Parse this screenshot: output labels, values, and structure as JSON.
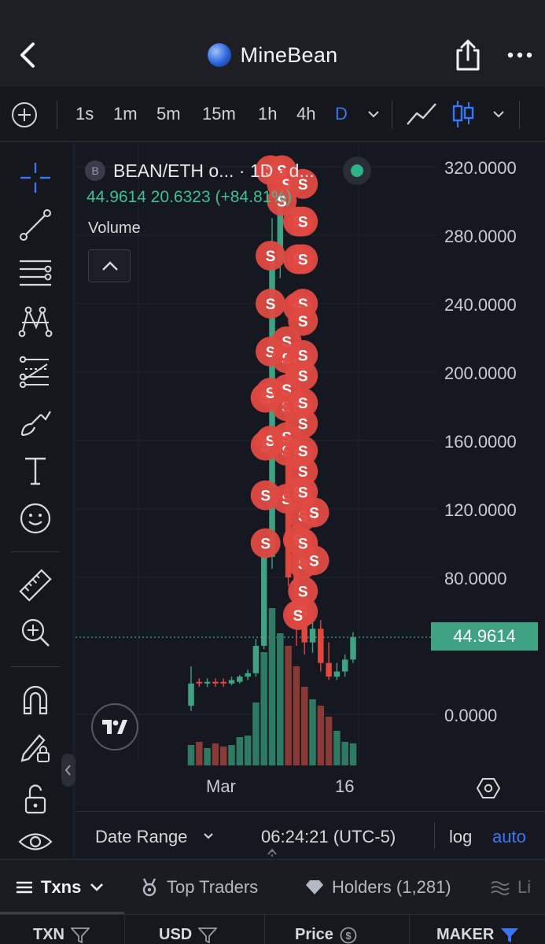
{
  "header": {
    "title": "MineBean"
  },
  "toolbar": {
    "timeframes": [
      "1s",
      "1m",
      "5m",
      "15m",
      "1h",
      "4h",
      "D"
    ],
    "active_timeframe": "D"
  },
  "chart": {
    "pair_label": "BEAN/ETH o... · 1D · d...",
    "coin_initial": "B",
    "ohlc_text": "44.9614  20.6323 (+84.81%)",
    "volume_label": "Volume",
    "current_price": "44.9614",
    "price_axis": [
      "320.0000",
      "280.0000",
      "240.0000",
      "200.0000",
      "160.0000",
      "120.0000",
      "80.0000",
      "0.0000"
    ],
    "time_axis": [
      "Mar",
      "16"
    ],
    "date_range_label": "Date Range",
    "clock": "06:24:21 (UTC-5)",
    "scale_log": "log",
    "scale_auto": "auto",
    "sell_marker_label": "S",
    "colors": {
      "up": "#3fa383",
      "down": "#e0473f",
      "marker": "#df4a42",
      "accent": "#3b76f6"
    }
  },
  "chart_data": {
    "type": "candlestick",
    "ylim": [
      0,
      320
    ],
    "y_ticks": [
      0,
      80,
      120,
      160,
      200,
      240,
      280,
      320
    ],
    "candles": [
      {
        "o": 5,
        "c": 18,
        "h": 28,
        "l": 2,
        "up": true
      },
      {
        "o": 19,
        "c": 18,
        "h": 21,
        "l": 16,
        "up": false
      },
      {
        "o": 18,
        "c": 19,
        "h": 21,
        "l": 16,
        "up": true
      },
      {
        "o": 19,
        "c": 18,
        "h": 21,
        "l": 16,
        "up": false
      },
      {
        "o": 19,
        "c": 18,
        "h": 21,
        "l": 16,
        "up": false
      },
      {
        "o": 18,
        "c": 20,
        "h": 22,
        "l": 17,
        "up": true
      },
      {
        "o": 19,
        "c": 22,
        "h": 23,
        "l": 18,
        "up": true
      },
      {
        "o": 22,
        "c": 24,
        "h": 26,
        "l": 20,
        "up": true
      },
      {
        "o": 24,
        "c": 40,
        "h": 44,
        "l": 22,
        "up": true
      },
      {
        "o": 40,
        "c": 92,
        "h": 95,
        "l": 38,
        "up": true
      },
      {
        "o": 92,
        "c": 265,
        "h": 290,
        "l": 85,
        "up": true
      },
      {
        "o": 265,
        "c": 305,
        "h": 318,
        "l": 255,
        "up": true
      },
      {
        "o": 220,
        "c": 80,
        "h": 225,
        "l": 75,
        "up": false
      },
      {
        "o": 92,
        "c": 60,
        "h": 95,
        "l": 40,
        "up": false
      },
      {
        "o": 62,
        "c": 42,
        "h": 70,
        "l": 35,
        "up": false
      },
      {
        "o": 42,
        "c": 50,
        "h": 58,
        "l": 36,
        "up": true
      },
      {
        "o": 50,
        "c": 30,
        "h": 55,
        "l": 25,
        "up": false
      },
      {
        "o": 30,
        "c": 22,
        "h": 42,
        "l": 20,
        "up": false
      },
      {
        "o": 22,
        "c": 25,
        "h": 30,
        "l": 20,
        "up": true
      },
      {
        "o": 25,
        "c": 32,
        "h": 35,
        "l": 22,
        "up": true
      },
      {
        "o": 32,
        "c": 45,
        "h": 48,
        "l": 30,
        "up": true
      }
    ],
    "volume": [
      {
        "v": 0.13,
        "up": true
      },
      {
        "v": 0.15,
        "up": false
      },
      {
        "v": 0.11,
        "up": true
      },
      {
        "v": 0.14,
        "up": false
      },
      {
        "v": 0.12,
        "up": false
      },
      {
        "v": 0.13,
        "up": true
      },
      {
        "v": 0.18,
        "up": true
      },
      {
        "v": 0.19,
        "up": true
      },
      {
        "v": 0.4,
        "up": true
      },
      {
        "v": 0.72,
        "up": true
      },
      {
        "v": 1.0,
        "up": true
      },
      {
        "v": 0.84,
        "up": true
      },
      {
        "v": 0.76,
        "up": false
      },
      {
        "v": 0.63,
        "up": false
      },
      {
        "v": 0.5,
        "up": false
      },
      {
        "v": 0.42,
        "up": true
      },
      {
        "v": 0.38,
        "up": false
      },
      {
        "v": 0.31,
        "up": false
      },
      {
        "v": 0.22,
        "up": true
      },
      {
        "v": 0.15,
        "up": true
      },
      {
        "v": 0.14,
        "up": true
      }
    ],
    "sell_markers": [
      {
        "i": 10,
        "p": 318
      },
      {
        "i": 11,
        "p": 310
      },
      {
        "i": 11,
        "p": 318
      },
      {
        "i": 12,
        "p": 310
      },
      {
        "i": 14,
        "p": 310
      },
      {
        "i": 11,
        "p": 300
      },
      {
        "i": 13,
        "p": 288
      },
      {
        "i": 14,
        "p": 288
      },
      {
        "i": 10,
        "p": 268
      },
      {
        "i": 13,
        "p": 266
      },
      {
        "i": 14,
        "p": 266
      },
      {
        "i": 10,
        "p": 240
      },
      {
        "i": 13,
        "p": 238
      },
      {
        "i": 14,
        "p": 240
      },
      {
        "i": 14,
        "p": 230
      },
      {
        "i": 10,
        "p": 212
      },
      {
        "i": 12,
        "p": 218
      },
      {
        "i": 12,
        "p": 208
      },
      {
        "i": 13,
        "p": 205
      },
      {
        "i": 14,
        "p": 210
      },
      {
        "i": 14,
        "p": 198
      },
      {
        "i": 9,
        "p": 185
      },
      {
        "i": 10,
        "p": 188
      },
      {
        "i": 12,
        "p": 190
      },
      {
        "i": 12,
        "p": 180
      },
      {
        "i": 13,
        "p": 180
      },
      {
        "i": 14,
        "p": 182
      },
      {
        "i": 14,
        "p": 170
      },
      {
        "i": 9,
        "p": 157
      },
      {
        "i": 10,
        "p": 160
      },
      {
        "i": 12,
        "p": 162
      },
      {
        "i": 12,
        "p": 154
      },
      {
        "i": 13,
        "p": 152
      },
      {
        "i": 14,
        "p": 154
      },
      {
        "i": 14,
        "p": 142
      },
      {
        "i": 9,
        "p": 128
      },
      {
        "i": 12,
        "p": 126
      },
      {
        "i": 13,
        "p": 130
      },
      {
        "i": 14,
        "p": 130
      },
      {
        "i": 14,
        "p": 116
      },
      {
        "i": 15,
        "p": 118
      },
      {
        "i": 9,
        "p": 100
      },
      {
        "i": 13,
        "p": 102
      },
      {
        "i": 14,
        "p": 100
      },
      {
        "i": 14,
        "p": 88
      },
      {
        "i": 15,
        "p": 90
      },
      {
        "i": 14,
        "p": 72
      },
      {
        "i": 14,
        "p": 60
      },
      {
        "i": 13,
        "p": 58
      }
    ]
  },
  "tabs": [
    {
      "label": "Txns"
    },
    {
      "label": "Top Traders"
    },
    {
      "label": "Holders (1,281)"
    },
    {
      "label": "Li"
    }
  ],
  "table_header": {
    "txn": "TXN",
    "usd": "USD",
    "price": "Price",
    "maker": "MAKER"
  }
}
